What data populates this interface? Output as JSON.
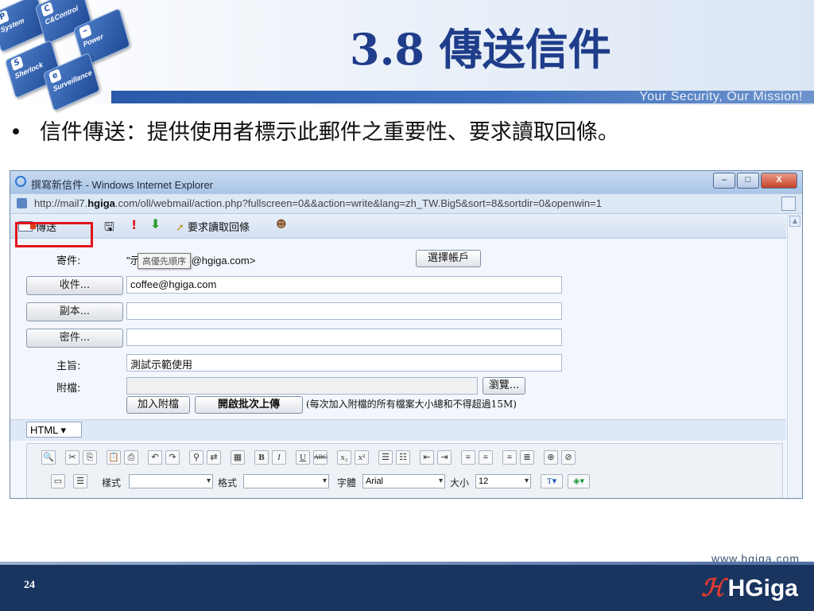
{
  "slide": {
    "title": "3.8 傳送信件",
    "tagline": "Your Security, Our Mission!",
    "bullet": "信件傳送：提供使用者標示此郵件之重要性、要求讀取回條。",
    "tiles": [
      "System",
      "C&Control",
      "Power",
      "Sherlock",
      "Surveillance"
    ],
    "website": "www.hgiga.com",
    "page_number": "24",
    "logo": "HGiga"
  },
  "window": {
    "title": "撰寫新信件 - Windows Internet Explorer",
    "url_prefix": "http://mail7.",
    "url_domain": "hgiga",
    "url_rest": ".com/oll/webmail/action.php?fullscreen=0&&action=write&lang=zh_TW.Big5&sort=8&sortdir=0&openwin=1",
    "buttons": {
      "minimize": "–",
      "maximize": "□",
      "close": "X"
    }
  },
  "toolbar": {
    "send": "傳送",
    "read_receipt": "要求讀取回條"
  },
  "form": {
    "from_label": "寄件:",
    "from_value": "\"示範 <demo1@hgiga.com>",
    "tooltip": "高優先順序",
    "choose_account": "選擇帳戶",
    "to_button": "收件...",
    "to_value": "coffee@hgiga.com",
    "cc_button": "副本...",
    "cc_value": "",
    "bcc_button": "密件...",
    "bcc_value": "",
    "subject_label": "主旨:",
    "subject_value": "測試示範使用",
    "attach_label": "附檔:",
    "browse": "瀏覽...",
    "add_attachment": "加入附檔",
    "batch_upload": "開啟批次上傳",
    "note": "(每次加入附檔的所有檔案大小總和不得超過15M)"
  },
  "editor": {
    "format": "HTML",
    "style_label": "樣式",
    "format_label": "格式",
    "font_label": "字體",
    "font_value": "Arial",
    "size_label": "大小",
    "size_value": "12"
  }
}
